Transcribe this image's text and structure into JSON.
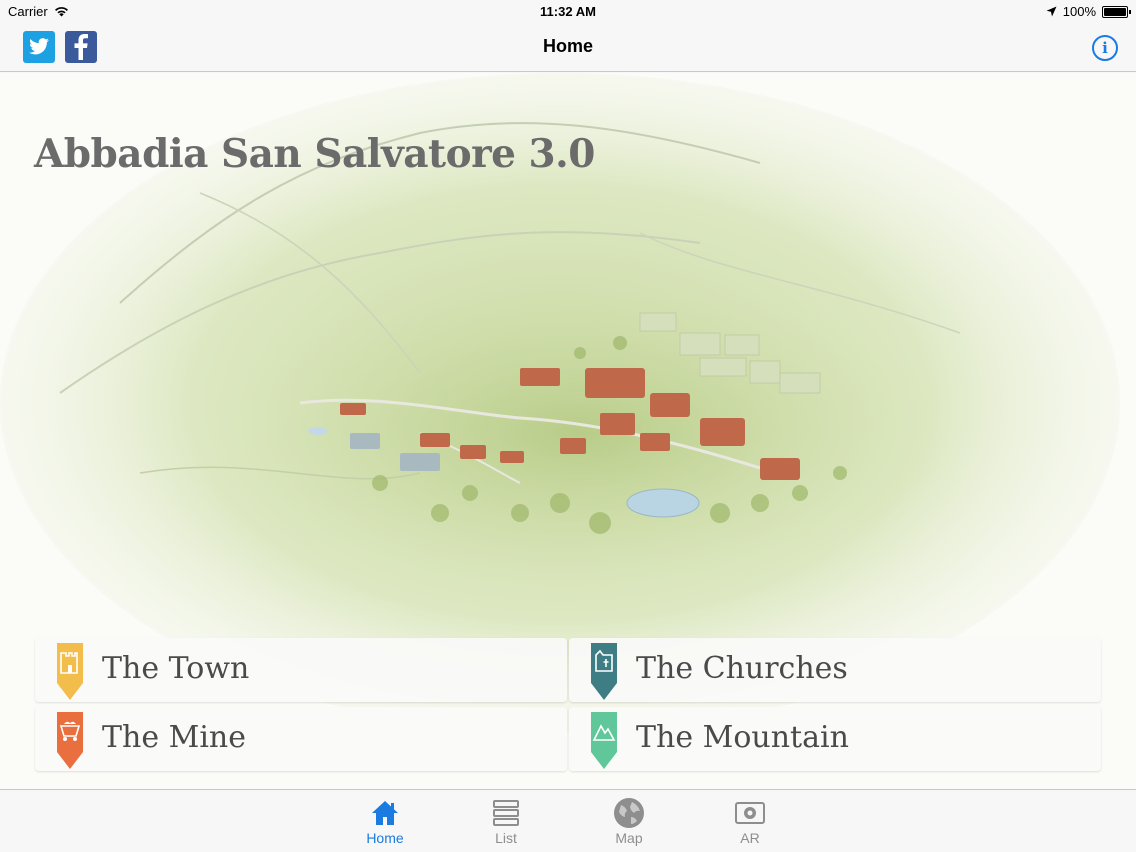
{
  "status_bar": {
    "carrier": "Carrier",
    "time": "11:32 AM",
    "battery": "100%",
    "battery_level": 1.0
  },
  "nav": {
    "title": "Home"
  },
  "main": {
    "title": "Abbadia San Salvatore 3.0"
  },
  "categories": [
    {
      "label": "The Town",
      "color": "#f2bd4a",
      "icon": "castle-tower-icon"
    },
    {
      "label": "The Churches",
      "color": "#3f7d85",
      "icon": "church-icon"
    },
    {
      "label": "The Mine",
      "color": "#e96f3e",
      "icon": "mine-cart-icon"
    },
    {
      "label": "The Mountain",
      "color": "#5fc79a",
      "icon": "mountain-icon"
    }
  ],
  "tabs": [
    {
      "label": "Home",
      "icon": "house-icon",
      "active": true
    },
    {
      "label": "List",
      "icon": "list-icon",
      "active": false
    },
    {
      "label": "Map",
      "icon": "globe-icon",
      "active": false
    },
    {
      "label": "AR",
      "icon": "camera-icon",
      "active": false
    }
  ],
  "colors": {
    "accent": "#1a7be0",
    "twitter": "#1da1e2",
    "facebook": "#3b5a9c"
  }
}
